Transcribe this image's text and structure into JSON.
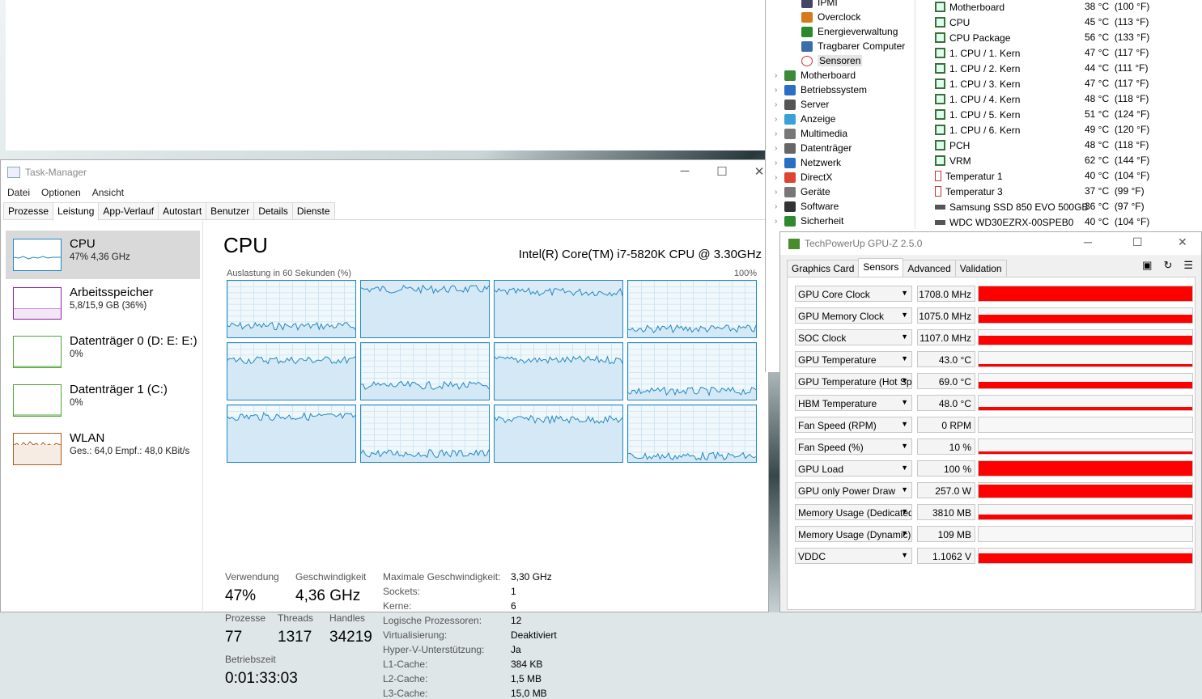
{
  "taskmgr": {
    "title": "Task-Manager",
    "menu": [
      "Datei",
      "Optionen",
      "Ansicht"
    ],
    "tabs": [
      "Prozesse",
      "Leistung",
      "App-Verlauf",
      "Autostart",
      "Benutzer",
      "Details",
      "Dienste"
    ],
    "active_tab": "Leistung",
    "sidebar": [
      {
        "title": "CPU",
        "sub": "47% 4,36 GHz",
        "color": "#1f87c2"
      },
      {
        "title": "Arbeitsspeicher",
        "sub": "5,8/15,9 GB (36%)",
        "color": "#8b1fa8"
      },
      {
        "title": "Datenträger 0 (D: E: E:)",
        "sub": "0%",
        "color": "#4da632"
      },
      {
        "title": "Datenträger 1 (C:)",
        "sub": "0%",
        "color": "#4da632"
      },
      {
        "title": "WLAN",
        "sub": "Ges.: 64,0  Empf.: 48,0 KBit/s",
        "color": "#a75a1b"
      }
    ],
    "cpu_heading": "CPU",
    "cpu_model": "Intel(R) Core(TM) i7-5820K CPU @ 3.30GHz",
    "util_label": "Auslastung in 60 Sekunden (%)",
    "util_max": "100%",
    "stats": {
      "verwendung_label": "Verwendung",
      "verwendung": "47%",
      "geschw_label": "Geschwindigkeit",
      "geschw": "4,36 GHz",
      "prozesse_label": "Prozesse",
      "prozesse": "77",
      "threads_label": "Threads",
      "threads": "1317",
      "handles_label": "Handles",
      "handles": "34219",
      "betriebszeit_label": "Betriebszeit",
      "betriebszeit": "0:01:33:03"
    },
    "details": [
      {
        "k": "Maximale Geschwindigkeit:",
        "v": "3,30 GHz"
      },
      {
        "k": "Sockets:",
        "v": "1"
      },
      {
        "k": "Kerne:",
        "v": "6"
      },
      {
        "k": "Logische Prozessoren:",
        "v": "12"
      },
      {
        "k": "Virtualisierung:",
        "v": "Deaktiviert"
      },
      {
        "k": "Hyper-V-Unterstützung:",
        "v": "Ja"
      },
      {
        "k": "L1-Cache:",
        "v": "384 KB"
      },
      {
        "k": "L2-Cache:",
        "v": "1,5 MB"
      },
      {
        "k": "L3-Cache:",
        "v": "15,0 MB"
      }
    ]
  },
  "aida": {
    "tree": [
      {
        "label": "IPMI",
        "indent": 2
      },
      {
        "label": "Overclock",
        "indent": 2
      },
      {
        "label": "Energieverwaltung",
        "indent": 2
      },
      {
        "label": "Tragbarer Computer",
        "indent": 2
      },
      {
        "label": "Sensoren",
        "indent": 2,
        "selected": true
      },
      {
        "label": "Motherboard",
        "indent": 1
      },
      {
        "label": "Betriebssystem",
        "indent": 1
      },
      {
        "label": "Server",
        "indent": 1
      },
      {
        "label": "Anzeige",
        "indent": 1
      },
      {
        "label": "Multimedia",
        "indent": 1
      },
      {
        "label": "Datenträger",
        "indent": 1
      },
      {
        "label": "Netzwerk",
        "indent": 1
      },
      {
        "label": "DirectX",
        "indent": 1
      },
      {
        "label": "Geräte",
        "indent": 1
      },
      {
        "label": "Software",
        "indent": 1
      },
      {
        "label": "Sicherheit",
        "indent": 1
      }
    ],
    "sensors": [
      {
        "name": "Motherboard",
        "val": "38 °C  (100 °F)"
      },
      {
        "name": "CPU",
        "val": "45 °C  (113 °F)"
      },
      {
        "name": "CPU Package",
        "val": "56 °C  (133 °F)"
      },
      {
        "name": "1. CPU / 1. Kern",
        "val": "47 °C  (117 °F)"
      },
      {
        "name": "1. CPU / 2. Kern",
        "val": "44 °C  (111 °F)"
      },
      {
        "name": "1. CPU / 3. Kern",
        "val": "47 °C  (117 °F)"
      },
      {
        "name": "1. CPU / 4. Kern",
        "val": "48 °C  (118 °F)"
      },
      {
        "name": "1. CPU / 5. Kern",
        "val": "51 °C  (124 °F)"
      },
      {
        "name": "1. CPU / 6. Kern",
        "val": "49 °C  (120 °F)"
      },
      {
        "name": "PCH",
        "val": "48 °C  (118 °F)"
      },
      {
        "name": "VRM",
        "val": "62 °C  (144 °F)"
      },
      {
        "name": "Temperatur 1",
        "val": "40 °C  (104 °F)"
      },
      {
        "name": "Temperatur 3",
        "val": "37 °C  (99 °F)"
      },
      {
        "name": "Samsung SSD 850 EVO 500GB",
        "val": "36 °C  (97 °F)"
      },
      {
        "name": "WDC WD30EZRX-00SPEB0",
        "val": "40 °C  (104 °F)"
      }
    ]
  },
  "gpuz": {
    "title": "TechPowerUp GPU-Z 2.5.0",
    "tabs": [
      "Graphics Card",
      "Sensors",
      "Advanced",
      "Validation"
    ],
    "active_tab": "Sensors",
    "rows": [
      {
        "name": "GPU Core Clock",
        "val": "1708.0 MHz",
        "fill": 1.0
      },
      {
        "name": "GPU Memory Clock",
        "val": "1075.0 MHz",
        "fill": 0.75
      },
      {
        "name": "SOC Clock",
        "val": "1107.0 MHz",
        "fill": 0.8
      },
      {
        "name": "GPU Temperature",
        "val": "43.0 °C",
        "fill": 0.25
      },
      {
        "name": "GPU Temperature (Hot Spot)",
        "val": "69.0 °C",
        "fill": 0.55
      },
      {
        "name": "HBM Temperature",
        "val": "48.0 °C",
        "fill": 0.3
      },
      {
        "name": "Fan Speed (RPM)",
        "val": "0 RPM",
        "fill": 0
      },
      {
        "name": "Fan Speed (%)",
        "val": "10 %",
        "fill": 0.1
      },
      {
        "name": "GPU Load",
        "val": "100 %",
        "fill": 1.0
      },
      {
        "name": "GPU only Power Draw",
        "val": "257.0 W",
        "fill": 0.9
      },
      {
        "name": "Memory Usage (Dedicated)",
        "val": "3810 MB",
        "fill": 0.4
      },
      {
        "name": "Memory Usage (Dynamic)",
        "val": "109 MB",
        "fill": 0
      },
      {
        "name": "VDDC",
        "val": "1.1062 V",
        "fill": 0.85
      }
    ]
  }
}
